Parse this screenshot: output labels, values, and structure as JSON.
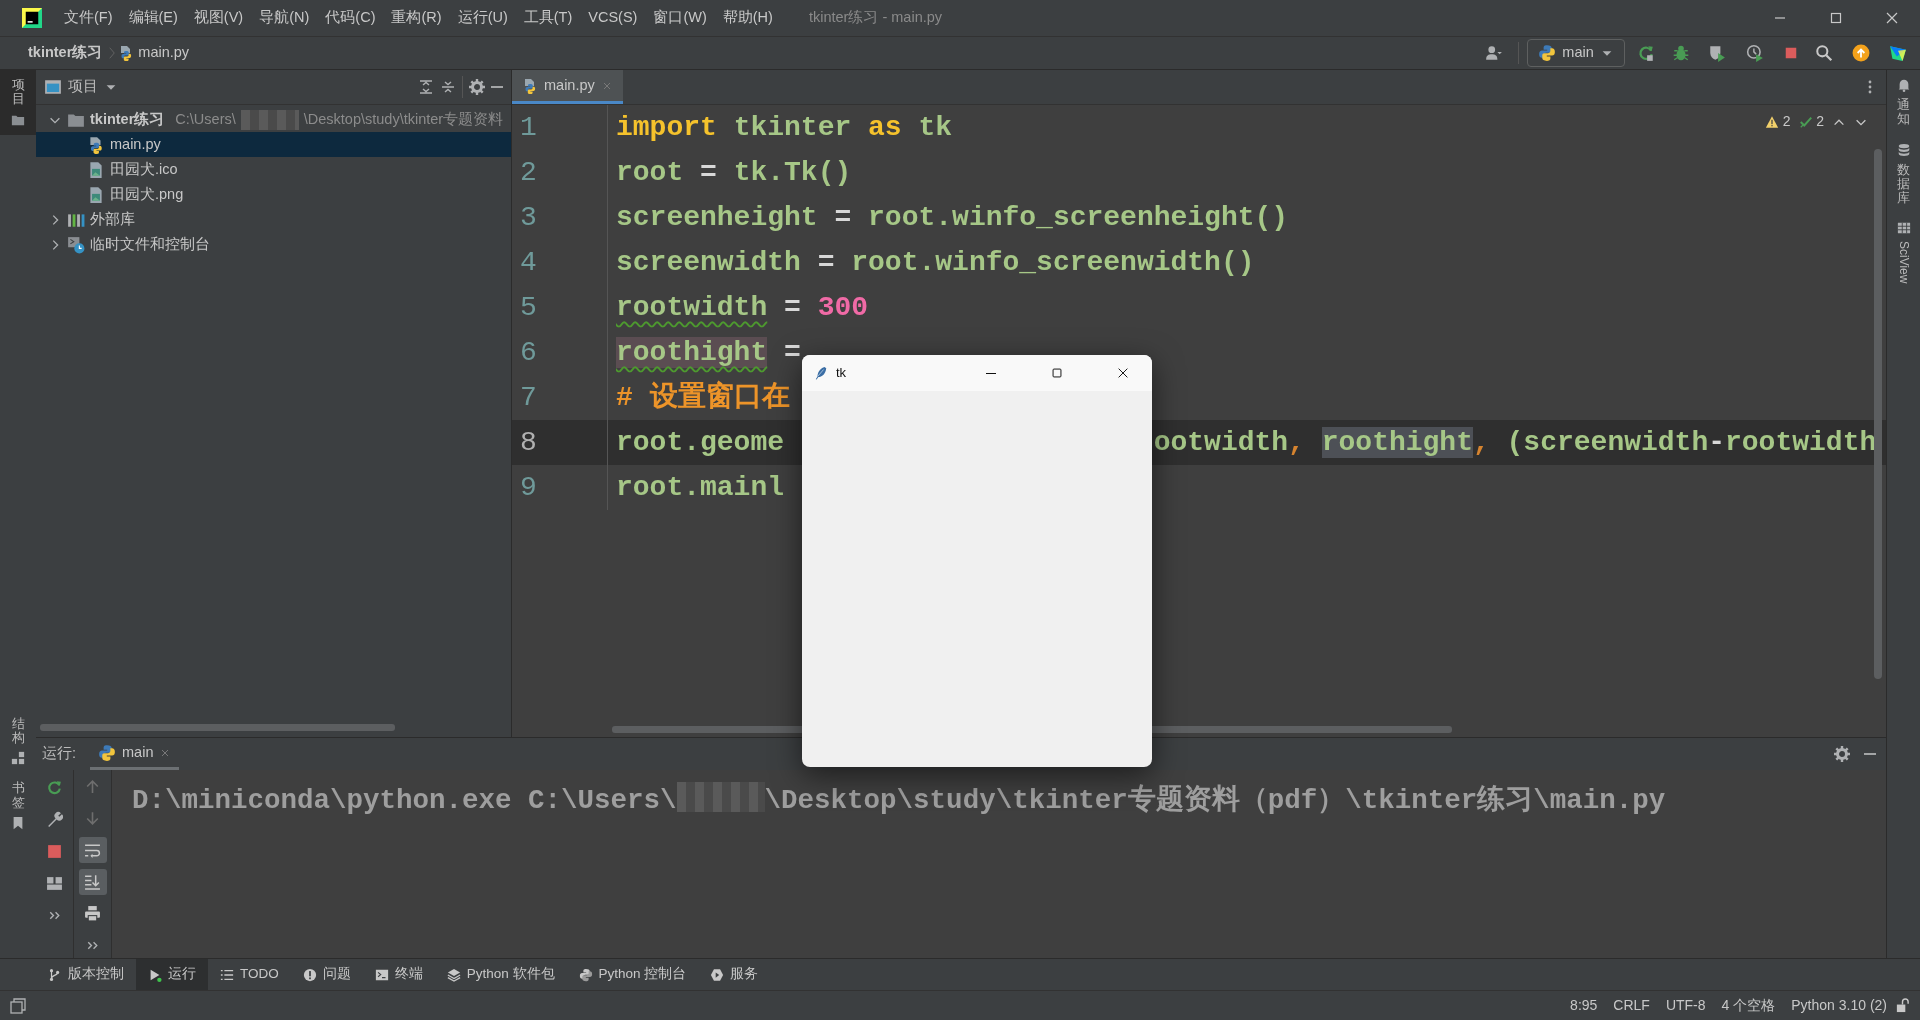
{
  "window": {
    "title": "tkinter练习 - main.py",
    "menu": [
      "文件(F)",
      "编辑(E)",
      "视图(V)",
      "导航(N)",
      "代码(C)",
      "重构(R)",
      "运行(U)",
      "工具(T)",
      "VCS(S)",
      "窗口(W)",
      "帮助(H)"
    ]
  },
  "breadcrumb": [
    "tkinter练习",
    "main.py"
  ],
  "run_config": {
    "label": "main"
  },
  "left_strip": {
    "top": [
      {
        "label": "项目",
        "selected": true
      }
    ],
    "bottom": [
      {
        "label": "结构",
        "kind": "structure"
      },
      {
        "label": "书签",
        "kind": "bookmark"
      }
    ]
  },
  "right_strip": [
    {
      "label": "通知",
      "kind": "bell"
    },
    {
      "label": "数据库",
      "kind": "database"
    },
    {
      "label": "SciView",
      "kind": "grid"
    }
  ],
  "project": {
    "title": "项目",
    "tree": [
      {
        "label": "tkinter练习",
        "kind": "folder",
        "path_parts": [
          "C:\\Users\\",
          "\\Desktop\\study\\tkinter专题资料"
        ],
        "expanded": true,
        "selected": false,
        "children": [
          {
            "label": "main.py",
            "kind": "python",
            "selected": true
          },
          {
            "label": "田园犬.ico",
            "kind": "image",
            "selected": false
          },
          {
            "label": "田园犬.png",
            "kind": "image",
            "selected": false
          }
        ]
      },
      {
        "label": "外部库",
        "kind": "library",
        "expanded": false,
        "selected": false
      },
      {
        "label": "临时文件和控制台",
        "kind": "scratch",
        "expanded": false,
        "selected": false
      }
    ]
  },
  "editor": {
    "tabs": [
      {
        "label": "main.py",
        "selected": true
      }
    ],
    "inspections": [
      {
        "kind": "warning",
        "count": "2"
      },
      {
        "kind": "weak",
        "count": "2"
      }
    ],
    "lines": [
      {
        "number": "1",
        "current": false,
        "segments": [
          [
            {
              "text": "import",
              "kind": "kw"
            },
            {
              "text": " tkinter ",
              "kind": "id"
            },
            {
              "text": "as",
              "kind": "kw"
            },
            {
              "text": " tk",
              "kind": "id"
            }
          ]
        ]
      },
      {
        "number": "2",
        "current": false,
        "segments": [
          [
            {
              "text": "root",
              "kind": "id"
            },
            {
              "text": " = ",
              "kind": "op"
            },
            {
              "text": "tk.Tk()",
              "kind": "id"
            }
          ]
        ]
      },
      {
        "number": "3",
        "current": false,
        "segments": [
          [
            {
              "text": "screenheight",
              "kind": "id"
            },
            {
              "text": " = ",
              "kind": "op"
            },
            {
              "text": "root.winfo_screenheight()",
              "kind": "id"
            }
          ]
        ]
      },
      {
        "number": "4",
        "current": false,
        "segments": [
          [
            {
              "text": "screenwidth",
              "kind": "id"
            },
            {
              "text": " = ",
              "kind": "op"
            },
            {
              "text": "root.winfo_screenwidth()",
              "kind": "id"
            }
          ]
        ]
      },
      {
        "number": "5",
        "current": false,
        "segments": [
          [
            {
              "text": "rootwidth",
              "kind": "id",
              "typo": true
            },
            {
              "text": " = ",
              "kind": "op"
            },
            {
              "text": "300",
              "kind": "num"
            }
          ]
        ]
      },
      {
        "number": "6",
        "current": false,
        "segments": [
          [
            {
              "text": "roothight",
              "kind": "id",
              "typo": true,
              "write_usage": true
            },
            {
              "text": " =",
              "kind": "op"
            }
          ]
        ]
      },
      {
        "number": "7",
        "current": false,
        "segments": [
          [
            {
              "text": "# 设置窗口在",
              "kind": "cmt"
            }
          ]
        ]
      },
      {
        "number": "8",
        "current": true,
        "segments": [
          [
            {
              "text": "root.geome",
              "kind": "id"
            }
          ],
          [
            {
              "text": "ootwidth",
              "kind": "id"
            },
            {
              "text": ", ",
              "kind": "comma"
            },
            {
              "text": "roothight",
              "kind": "id",
              "read_usage": true
            },
            {
              "text": ", ",
              "kind": "comma"
            },
            {
              "text": "(screenwidth",
              "kind": "id"
            },
            {
              "text": "-",
              "kind": "op"
            },
            {
              "text": "rootwidth",
              "kind": "id"
            }
          ]
        ]
      },
      {
        "number": "9",
        "current": false,
        "segments": [
          [
            {
              "text": "root.mainl",
              "kind": "id"
            }
          ]
        ]
      }
    ]
  },
  "tk_window": {
    "title": "tk"
  },
  "run": {
    "label": "运行:",
    "tabs": [
      {
        "label": "main",
        "selected": true
      }
    ],
    "tools": [
      {
        "kind": "up",
        "on": false
      },
      {
        "kind": "down",
        "on": false
      },
      {
        "kind": "wrap",
        "on": true
      },
      {
        "kind": "scroll-end",
        "on": true
      },
      {
        "kind": "print",
        "on": false
      }
    ],
    "output_parts": [
      "D:\\miniconda\\python.exe C:\\Users\\",
      "\\Desktop\\study\\tkinter专题资料（pdf）\\tkinter练习\\main.py"
    ]
  },
  "tool_windows": [
    {
      "label": "版本控制",
      "kind": "branch",
      "selected": false
    },
    {
      "label": "运行",
      "kind": "run",
      "selected": true
    },
    {
      "label": "TODO",
      "kind": "list",
      "selected": false
    },
    {
      "label": "问题",
      "kind": "problem",
      "selected": false
    },
    {
      "label": "终端",
      "kind": "terminal",
      "selected": false
    },
    {
      "label": "Python 软件包",
      "kind": "layers",
      "selected": false
    },
    {
      "label": "Python 控制台",
      "kind": "python",
      "selected": false
    },
    {
      "label": "服务",
      "kind": "service",
      "selected": false
    }
  ],
  "status_bar": [
    "8:95",
    "CRLF",
    "UTF-8",
    "4 个空格",
    "Python 3.10 (2)"
  ]
}
